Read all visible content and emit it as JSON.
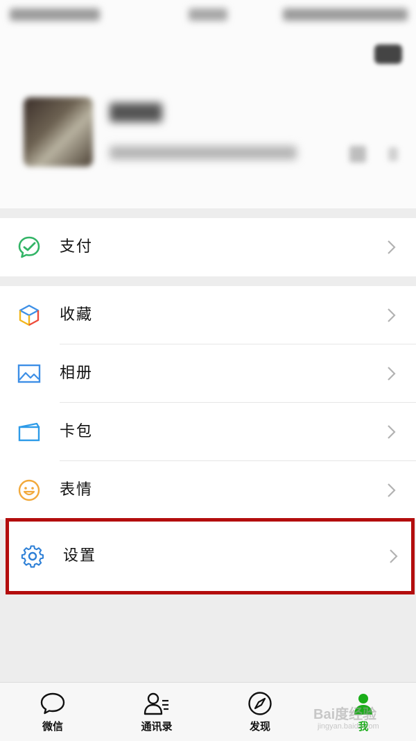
{
  "menu": {
    "pay": {
      "label": "支付",
      "icon": "wechat-pay-icon"
    },
    "favorites": {
      "label": "收藏",
      "icon": "favorites-cube-icon"
    },
    "album": {
      "label": "相册",
      "icon": "photo-album-icon"
    },
    "cards": {
      "label": "卡包",
      "icon": "card-wallet-icon"
    },
    "stickers": {
      "label": "表情",
      "icon": "smiley-icon"
    },
    "settings": {
      "label": "设置",
      "icon": "gear-icon"
    }
  },
  "tabs": [
    {
      "label": "微信",
      "icon": "chat-bubble-icon",
      "active": false
    },
    {
      "label": "通讯录",
      "icon": "contacts-icon",
      "active": false
    },
    {
      "label": "发现",
      "icon": "compass-icon",
      "active": false
    },
    {
      "label": "我",
      "icon": "me-icon",
      "active": true
    }
  ],
  "watermark": {
    "text": "Bai度经验",
    "sub": "jingyan.baidu.com"
  },
  "colors": {
    "accent_green": "#1aad19",
    "highlight_red": "#b30d0d",
    "page_bg": "#ededed"
  }
}
